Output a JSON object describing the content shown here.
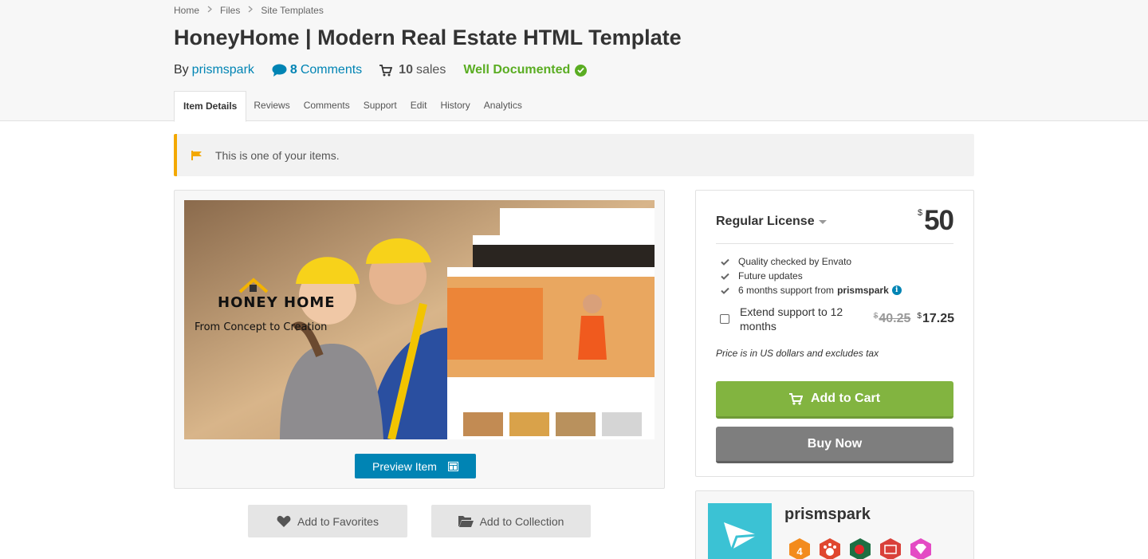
{
  "breadcrumb": [
    "Home",
    "Files",
    "Site Templates"
  ],
  "title": "HoneyHome | Modern Real Estate HTML Template",
  "meta": {
    "by_label": "By",
    "author": "prismspark",
    "comments_count": "8",
    "comments_label": "Comments",
    "sales_count": "10",
    "sales_label": "sales",
    "documented": "Well Documented"
  },
  "tabs": [
    "Item Details",
    "Reviews",
    "Comments",
    "Support",
    "Edit",
    "History",
    "Analytics"
  ],
  "notice": "This is one of your items.",
  "preview": {
    "brand_name": "HONEY HOME",
    "tagline": "From Concept to Creation",
    "preview_label": "Preview Item"
  },
  "actions": {
    "favorites": "Add to Favorites",
    "collection": "Add to Collection"
  },
  "purchase": {
    "license": "Regular License",
    "currency": "$",
    "price": "50",
    "features": [
      {
        "text": "Quality checked by Envato"
      },
      {
        "text": "Future updates"
      },
      {
        "text": "6 months support from",
        "author": "prismspark"
      }
    ],
    "extend_label": "Extend support to 12 months",
    "extend_old_price": "40.25",
    "extend_new_price": "17.25",
    "tax_note": "Price is in US dollars and excludes tax",
    "add_to_cart": "Add to Cart",
    "buy_now": "Buy Now"
  },
  "author_box": {
    "name": "prismspark",
    "badges": [
      "level-4-badge",
      "pet-badge",
      "country-badge",
      "sc-badge",
      "gem-badge"
    ]
  },
  "colors": {
    "link": "#0084b4",
    "success": "#5aad22",
    "cart": "#82b440",
    "buy": "#7e7e7e",
    "notice_accent": "#f3a800"
  }
}
